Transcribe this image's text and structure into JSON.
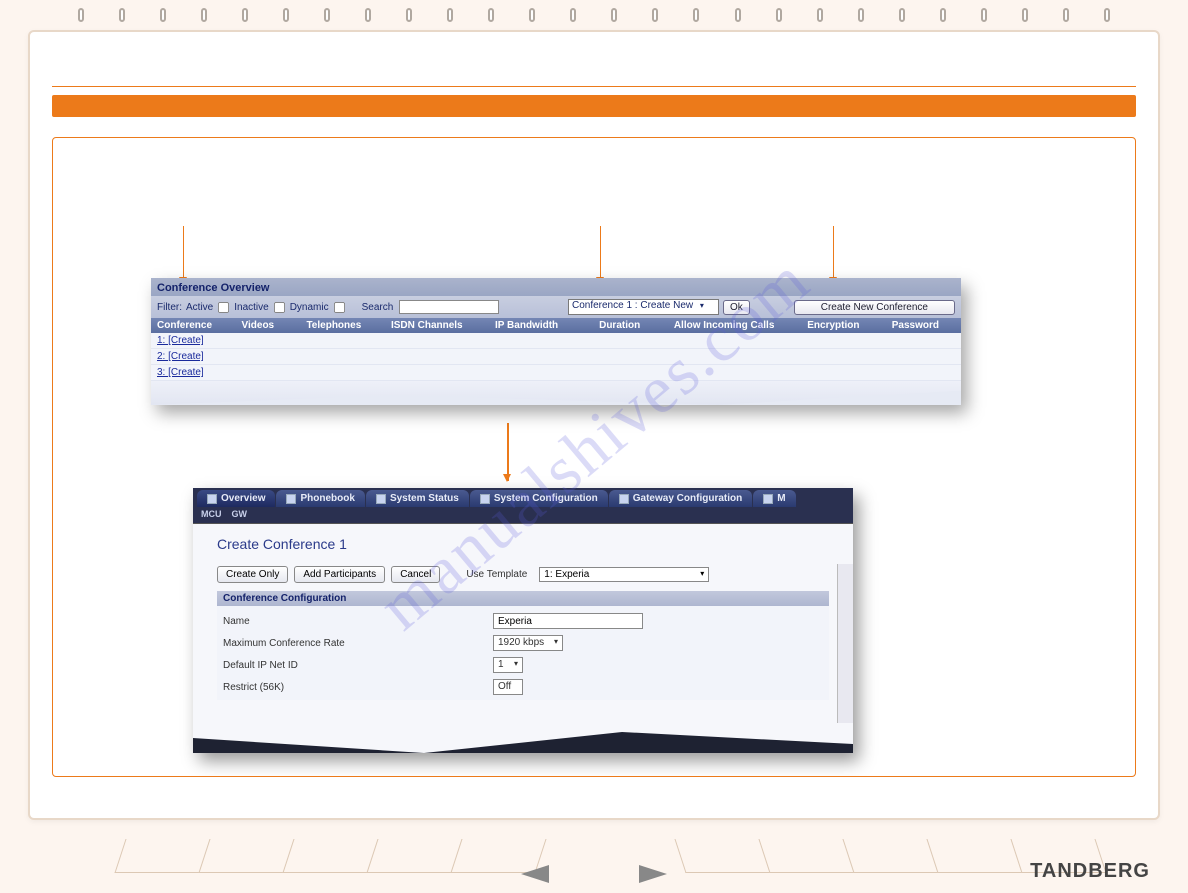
{
  "watermark": "manualshives.com",
  "brand": "TANDBERG",
  "overview": {
    "title": "Conference Overview",
    "filter_label": "Filter:",
    "active": "Active",
    "inactive": "Inactive",
    "dynamic": "Dynamic",
    "search_label": "Search",
    "select_value": "Conference 1 : Create New",
    "ok": "Ok",
    "create_new": "Create New Conference",
    "headers": {
      "conference": "Conference",
      "videos": "Videos",
      "telephones": "Telephones",
      "isdn": "ISDN Channels",
      "ip_bw": "IP Bandwidth",
      "duration": "Duration",
      "allow_incoming": "Allow Incoming Calls",
      "encryption": "Encryption",
      "password": "Password"
    },
    "rows": {
      "r1": "1: [Create]",
      "r2": "2: [Create]",
      "r3": "3: [Create]"
    }
  },
  "tabs": {
    "overview": "Overview",
    "phonebook": "Phonebook",
    "system_status": "System Status",
    "system_config": "System Configuration",
    "gateway_config": "Gateway Configuration",
    "more": "M",
    "sub_mcu": "MCU",
    "sub_gw": "GW"
  },
  "create": {
    "title": "Create Conference 1",
    "create_only": "Create Only",
    "add_participants": "Add Participants",
    "cancel": "Cancel",
    "use_template_label": "Use Template",
    "template_value": "1:   Experia",
    "section": "Conference Configuration",
    "name_label": "Name",
    "name_value": "Experia",
    "max_rate_label": "Maximum Conference Rate",
    "max_rate_value": "1920 kbps",
    "net_id_label": "Default IP Net ID",
    "net_id_value": "1",
    "restrict_label": "Restrict (56K)",
    "restrict_value": "Off"
  }
}
